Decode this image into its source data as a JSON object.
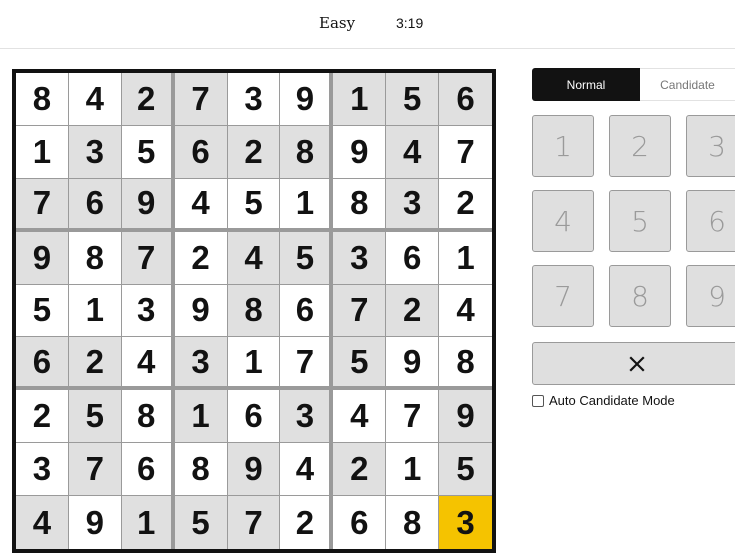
{
  "header": {
    "difficulty": "Easy",
    "timer": "3:19"
  },
  "board": {
    "selected": {
      "row": 9,
      "col": 9
    },
    "colors": {
      "given": "#e0e0e0",
      "empty": "#ffffff",
      "selected": "#f5c300"
    },
    "rows": [
      [
        {
          "v": "8",
          "given": false
        },
        {
          "v": "4",
          "given": false
        },
        {
          "v": "2",
          "given": true
        },
        {
          "v": "7",
          "given": true
        },
        {
          "v": "3",
          "given": false
        },
        {
          "v": "9",
          "given": false
        },
        {
          "v": "1",
          "given": true
        },
        {
          "v": "5",
          "given": true
        },
        {
          "v": "6",
          "given": true
        }
      ],
      [
        {
          "v": "1",
          "given": false
        },
        {
          "v": "3",
          "given": true
        },
        {
          "v": "5",
          "given": false
        },
        {
          "v": "6",
          "given": true
        },
        {
          "v": "2",
          "given": true
        },
        {
          "v": "8",
          "given": true
        },
        {
          "v": "9",
          "given": false
        },
        {
          "v": "4",
          "given": true
        },
        {
          "v": "7",
          "given": false
        }
      ],
      [
        {
          "v": "7",
          "given": true
        },
        {
          "v": "6",
          "given": true
        },
        {
          "v": "9",
          "given": true
        },
        {
          "v": "4",
          "given": false
        },
        {
          "v": "5",
          "given": false
        },
        {
          "v": "1",
          "given": false
        },
        {
          "v": "8",
          "given": false
        },
        {
          "v": "3",
          "given": true
        },
        {
          "v": "2",
          "given": false
        }
      ],
      [
        {
          "v": "9",
          "given": true
        },
        {
          "v": "8",
          "given": false
        },
        {
          "v": "7",
          "given": true
        },
        {
          "v": "2",
          "given": false
        },
        {
          "v": "4",
          "given": true
        },
        {
          "v": "5",
          "given": true
        },
        {
          "v": "3",
          "given": true
        },
        {
          "v": "6",
          "given": false
        },
        {
          "v": "1",
          "given": false
        }
      ],
      [
        {
          "v": "5",
          "given": false
        },
        {
          "v": "1",
          "given": false
        },
        {
          "v": "3",
          "given": false
        },
        {
          "v": "9",
          "given": false
        },
        {
          "v": "8",
          "given": true
        },
        {
          "v": "6",
          "given": false
        },
        {
          "v": "7",
          "given": true
        },
        {
          "v": "2",
          "given": true
        },
        {
          "v": "4",
          "given": false
        }
      ],
      [
        {
          "v": "6",
          "given": true
        },
        {
          "v": "2",
          "given": true
        },
        {
          "v": "4",
          "given": false
        },
        {
          "v": "3",
          "given": true
        },
        {
          "v": "1",
          "given": false
        },
        {
          "v": "7",
          "given": false
        },
        {
          "v": "5",
          "given": true
        },
        {
          "v": "9",
          "given": false
        },
        {
          "v": "8",
          "given": false
        }
      ],
      [
        {
          "v": "2",
          "given": false
        },
        {
          "v": "5",
          "given": true
        },
        {
          "v": "8",
          "given": false
        },
        {
          "v": "1",
          "given": true
        },
        {
          "v": "6",
          "given": false
        },
        {
          "v": "3",
          "given": true
        },
        {
          "v": "4",
          "given": false
        },
        {
          "v": "7",
          "given": false
        },
        {
          "v": "9",
          "given": true
        }
      ],
      [
        {
          "v": "3",
          "given": false
        },
        {
          "v": "7",
          "given": true
        },
        {
          "v": "6",
          "given": false
        },
        {
          "v": "8",
          "given": false
        },
        {
          "v": "9",
          "given": true
        },
        {
          "v": "4",
          "given": false
        },
        {
          "v": "2",
          "given": true
        },
        {
          "v": "1",
          "given": false
        },
        {
          "v": "5",
          "given": true
        }
      ],
      [
        {
          "v": "4",
          "given": true
        },
        {
          "v": "9",
          "given": false
        },
        {
          "v": "1",
          "given": true
        },
        {
          "v": "5",
          "given": true
        },
        {
          "v": "7",
          "given": true
        },
        {
          "v": "2",
          "given": false
        },
        {
          "v": "6",
          "given": false
        },
        {
          "v": "8",
          "given": false
        },
        {
          "v": "3",
          "given": false
        }
      ]
    ]
  },
  "controls": {
    "mode_tabs": [
      {
        "label": "Normal",
        "active": true
      },
      {
        "label": "Candidate",
        "active": false
      }
    ],
    "number_keys": [
      "1",
      "2",
      "3",
      "4",
      "5",
      "6",
      "7",
      "8",
      "9"
    ],
    "erase_icon": "close-icon",
    "auto_candidate_label": "Auto Candidate Mode",
    "auto_candidate_checked": false
  }
}
